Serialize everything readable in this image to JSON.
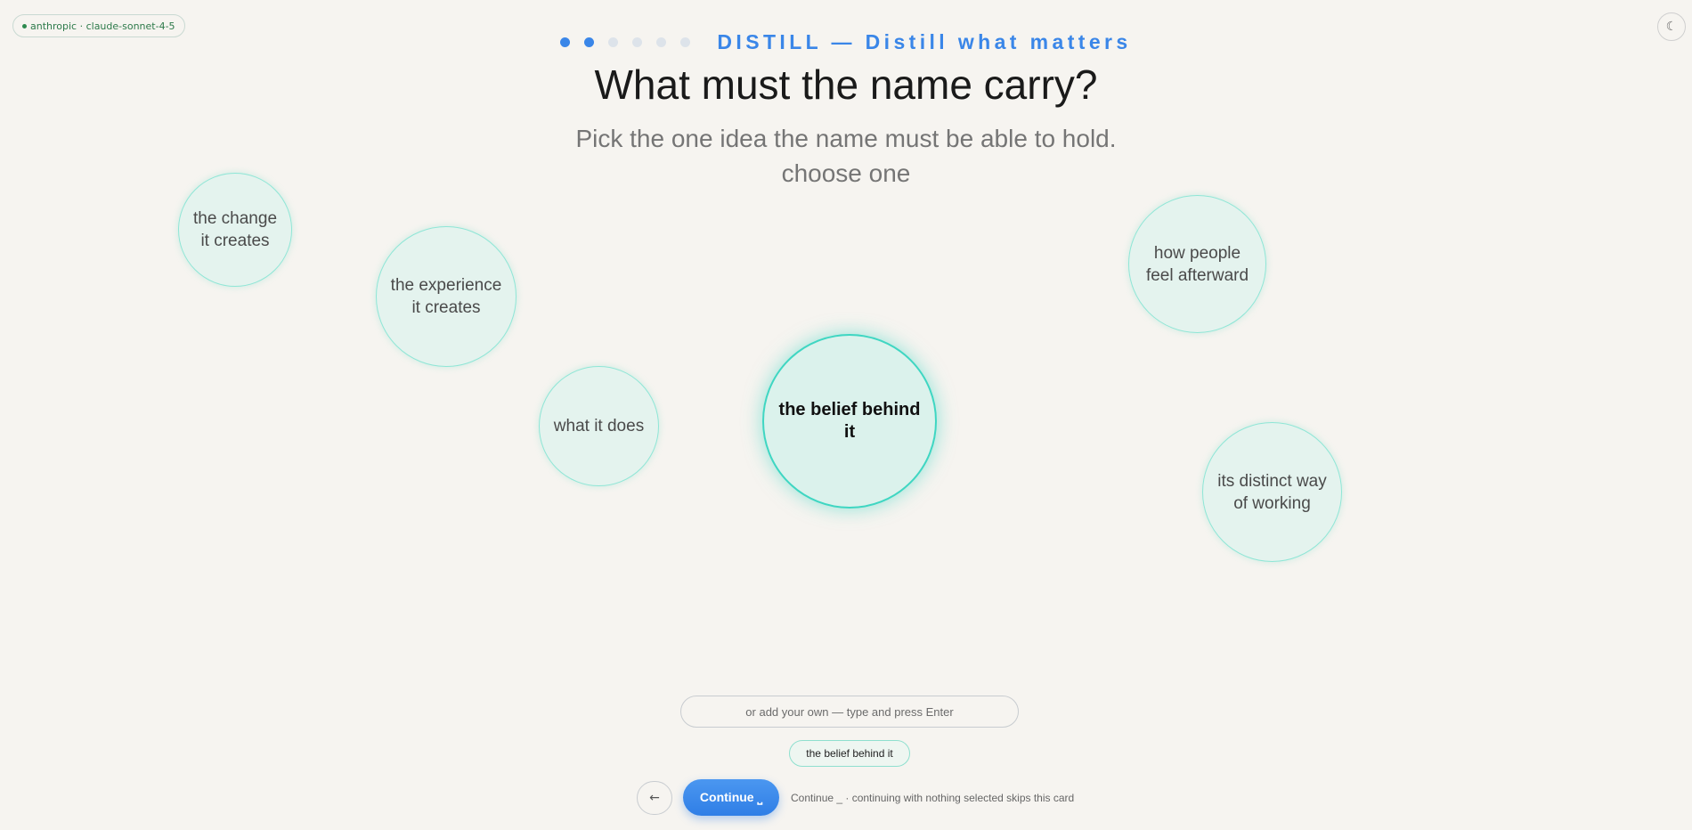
{
  "model_badge": {
    "label": "anthropic · claude-sonnet-4-5"
  },
  "theme_toggle": {
    "icon": "moon-icon",
    "glyph": "☾"
  },
  "progress": {
    "total_steps": 6,
    "current_step": 2
  },
  "step_label": "DISTILL — Distill what matters",
  "question": "What must the name carry?",
  "subtitle": {
    "line1": "Pick the one idea the name must be able to hold.",
    "line2": "choose one"
  },
  "options": [
    {
      "id": "change",
      "label_lines": [
        "the change",
        "it creates"
      ],
      "selected": false
    },
    {
      "id": "experience",
      "label_lines": [
        "the experience",
        "it creates"
      ],
      "selected": false
    },
    {
      "id": "what",
      "label_lines": [
        "what it does"
      ],
      "selected": false
    },
    {
      "id": "belief",
      "label_lines": [
        "the belief behind it"
      ],
      "selected": true
    },
    {
      "id": "feel",
      "label_lines": [
        "how people",
        "feel afterward"
      ],
      "selected": false
    },
    {
      "id": "distinct",
      "label_lines": [
        "its distinct way",
        "of working"
      ],
      "selected": false
    }
  ],
  "custom_input": {
    "placeholder": "or add your own — type and press Enter",
    "value": ""
  },
  "selected_chip": "the belief behind it",
  "back_button": {
    "glyph": "←"
  },
  "continue_button": {
    "label": "Continue ⎵"
  },
  "hint": "Continue _ · continuing with nothing selected skips this card",
  "colors": {
    "accent": "#3a86e8",
    "bubble_fill": "#e4f3ee",
    "bubble_border": "#8fe6d6",
    "selected_border": "#3fd6c2",
    "background": "#f6f4f0"
  }
}
